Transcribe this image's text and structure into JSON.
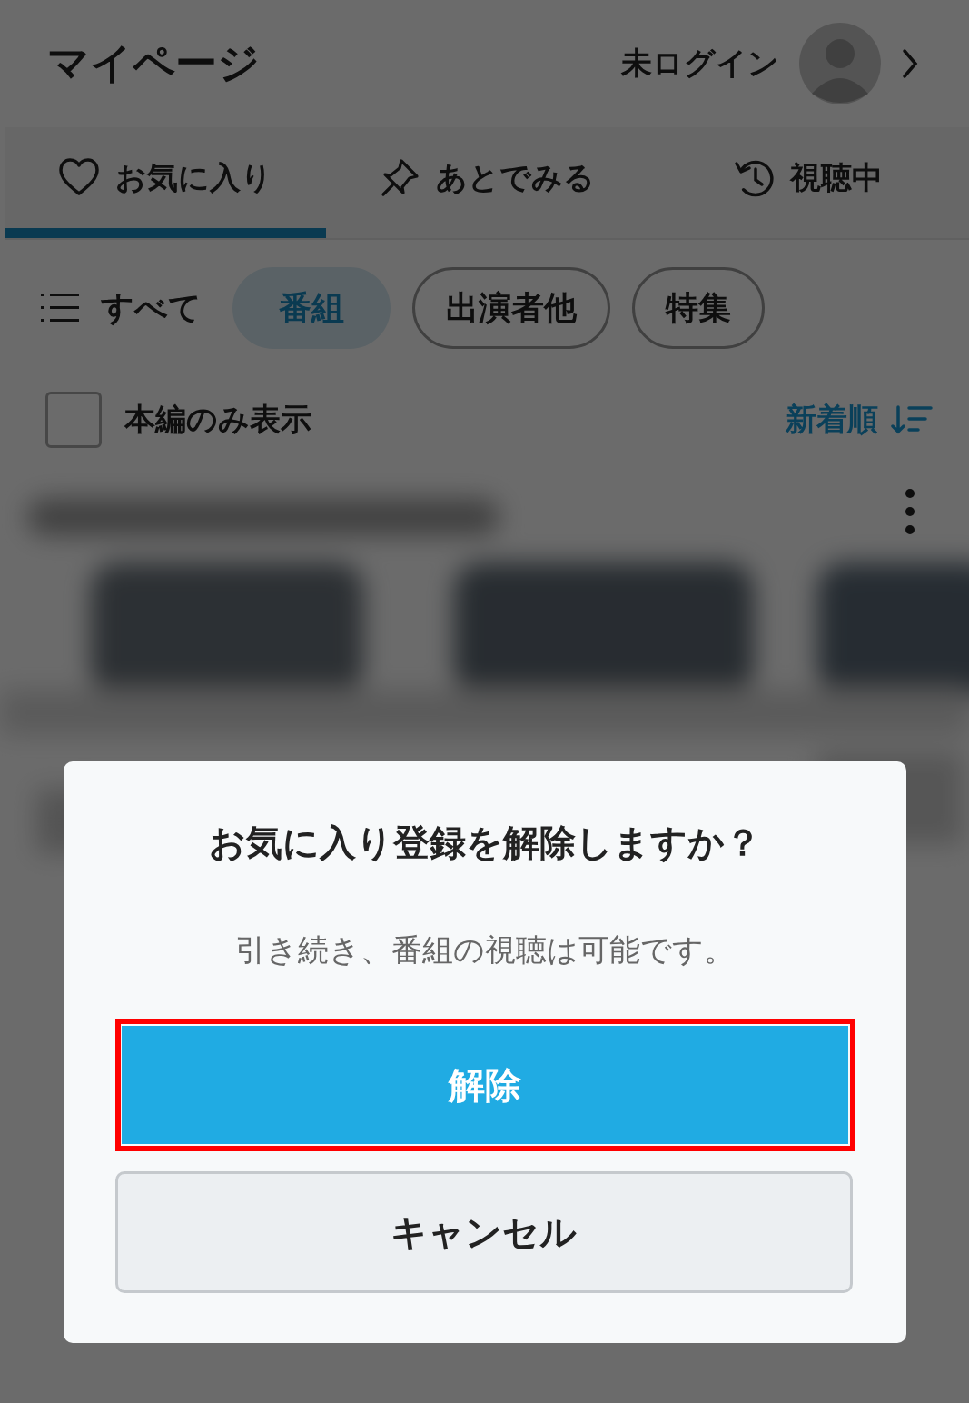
{
  "header": {
    "title": "マイページ",
    "login_status": "未ログイン"
  },
  "tabs": [
    {
      "label": "お気に入り",
      "kind": "heart",
      "selected": true
    },
    {
      "label": "あとでみる",
      "kind": "pin",
      "selected": false
    },
    {
      "label": "視聴中",
      "kind": "history",
      "selected": false
    }
  ],
  "filters": {
    "all_label": "すべて",
    "chips": [
      {
        "label": "番組",
        "selected": true
      },
      {
        "label": "出演者他",
        "selected": false
      },
      {
        "label": "特集",
        "selected": false
      }
    ]
  },
  "options": {
    "main_only": {
      "label": "本編のみ表示",
      "checked": false
    },
    "sort": {
      "label": "新着順"
    }
  },
  "dialog": {
    "title": "お気に入り登録を解除しますか？",
    "message": "引き続き、番組の視聴は可能です。",
    "buttons": [
      {
        "label": "解除",
        "kind": "primary",
        "highlighted": true
      },
      {
        "label": "キャンセル",
        "kind": "secondary",
        "highlighted": false
      }
    ]
  }
}
